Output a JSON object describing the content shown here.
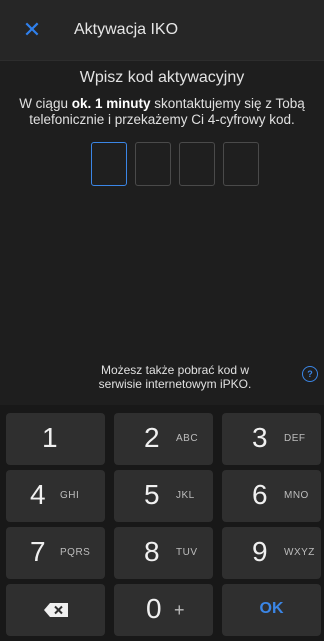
{
  "header": {
    "close_icon": "close-icon",
    "title": "Aktywacja IKO"
  },
  "main": {
    "title": "Wpisz kod aktywacyjny",
    "description_part1": "W ciągu ",
    "description_bold": "ok. 1 minuty",
    "description_part2": " skontaktujemy się z Tobą telefonicznie i przekażemy Ci 4-cyfrowy kod.",
    "code_boxes": 4,
    "hint": "Możesz także pobrać kod w serwisie internetowym iPKO.",
    "help_icon": "?"
  },
  "keypad": {
    "keys": [
      {
        "num": "1",
        "letters": ""
      },
      {
        "num": "2",
        "letters": "ABC"
      },
      {
        "num": "3",
        "letters": "DEF"
      },
      {
        "num": "4",
        "letters": "GHI"
      },
      {
        "num": "5",
        "letters": "JKL"
      },
      {
        "num": "6",
        "letters": "MNO"
      },
      {
        "num": "7",
        "letters": "PQRS"
      },
      {
        "num": "8",
        "letters": "TUV"
      },
      {
        "num": "9",
        "letters": "WXYZ"
      }
    ],
    "zero": "0",
    "zero_plus": "+",
    "ok": "OK",
    "backspace_icon": "backspace-icon"
  },
  "colors": {
    "accent": "#3b86e6",
    "background": "#1e1e1e",
    "key": "#2f2f2f"
  }
}
